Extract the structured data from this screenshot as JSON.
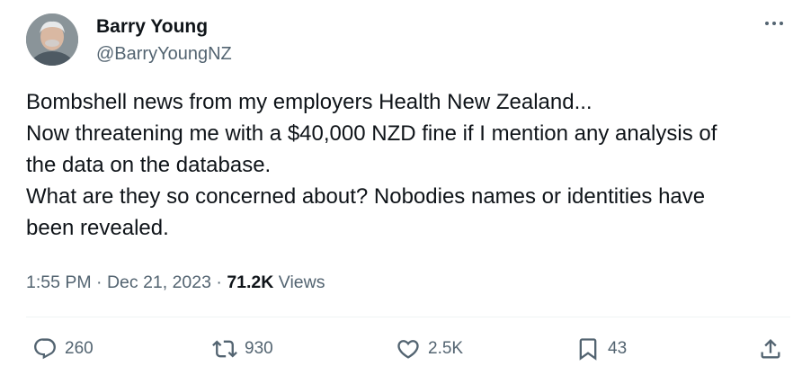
{
  "author": {
    "display_name": "Barry Young",
    "handle": "@BarryYoungNZ"
  },
  "tweet": {
    "lines": [
      "Bombshell news from my employers Health New Zealand...",
      "Now threatening me with a $40,000 NZD fine if I mention any analysis of",
      "the data on the database.",
      "What are they so concerned about?  Nobodies names or identities have",
      "been revealed."
    ],
    "time": "1:55 PM",
    "date": "Dec 21, 2023",
    "separator": "·",
    "views_count": "71.2K",
    "views_label": "Views"
  },
  "actions": {
    "replies": "260",
    "reposts": "930",
    "likes": "2.5K",
    "bookmarks": "43"
  },
  "icons": {
    "more": "more-horizontal-icon",
    "reply": "reply-icon",
    "repost": "repost-icon",
    "like": "heart-icon",
    "bookmark": "bookmark-icon",
    "share": "share-icon"
  },
  "colors": {
    "text": "#0f1419",
    "secondary": "#536471",
    "divider": "#eff3f4"
  }
}
